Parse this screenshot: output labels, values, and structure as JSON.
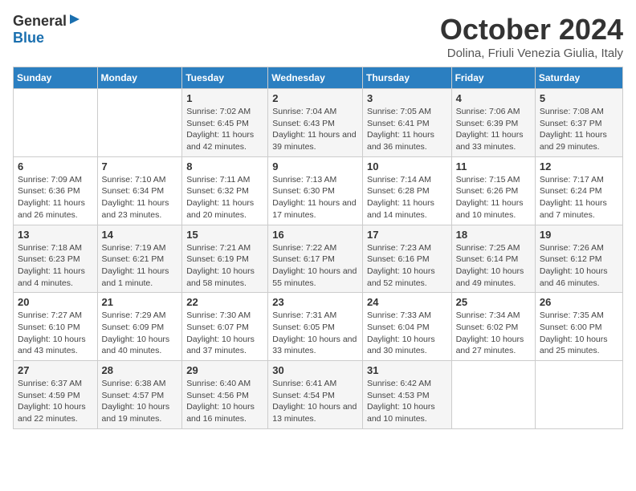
{
  "logo": {
    "line1": "General",
    "arrow": "►",
    "line2": "Blue"
  },
  "title": "October 2024",
  "location": "Dolina, Friuli Venezia Giulia, Italy",
  "days_of_week": [
    "Sunday",
    "Monday",
    "Tuesday",
    "Wednesday",
    "Thursday",
    "Friday",
    "Saturday"
  ],
  "weeks": [
    [
      {
        "day": "",
        "sunrise": "",
        "sunset": "",
        "daylight": ""
      },
      {
        "day": "",
        "sunrise": "",
        "sunset": "",
        "daylight": ""
      },
      {
        "day": "1",
        "sunrise": "Sunrise: 7:02 AM",
        "sunset": "Sunset: 6:45 PM",
        "daylight": "Daylight: 11 hours and 42 minutes."
      },
      {
        "day": "2",
        "sunrise": "Sunrise: 7:04 AM",
        "sunset": "Sunset: 6:43 PM",
        "daylight": "Daylight: 11 hours and 39 minutes."
      },
      {
        "day": "3",
        "sunrise": "Sunrise: 7:05 AM",
        "sunset": "Sunset: 6:41 PM",
        "daylight": "Daylight: 11 hours and 36 minutes."
      },
      {
        "day": "4",
        "sunrise": "Sunrise: 7:06 AM",
        "sunset": "Sunset: 6:39 PM",
        "daylight": "Daylight: 11 hours and 33 minutes."
      },
      {
        "day": "5",
        "sunrise": "Sunrise: 7:08 AM",
        "sunset": "Sunset: 6:37 PM",
        "daylight": "Daylight: 11 hours and 29 minutes."
      }
    ],
    [
      {
        "day": "6",
        "sunrise": "Sunrise: 7:09 AM",
        "sunset": "Sunset: 6:36 PM",
        "daylight": "Daylight: 11 hours and 26 minutes."
      },
      {
        "day": "7",
        "sunrise": "Sunrise: 7:10 AM",
        "sunset": "Sunset: 6:34 PM",
        "daylight": "Daylight: 11 hours and 23 minutes."
      },
      {
        "day": "8",
        "sunrise": "Sunrise: 7:11 AM",
        "sunset": "Sunset: 6:32 PM",
        "daylight": "Daylight: 11 hours and 20 minutes."
      },
      {
        "day": "9",
        "sunrise": "Sunrise: 7:13 AM",
        "sunset": "Sunset: 6:30 PM",
        "daylight": "Daylight: 11 hours and 17 minutes."
      },
      {
        "day": "10",
        "sunrise": "Sunrise: 7:14 AM",
        "sunset": "Sunset: 6:28 PM",
        "daylight": "Daylight: 11 hours and 14 minutes."
      },
      {
        "day": "11",
        "sunrise": "Sunrise: 7:15 AM",
        "sunset": "Sunset: 6:26 PM",
        "daylight": "Daylight: 11 hours and 10 minutes."
      },
      {
        "day": "12",
        "sunrise": "Sunrise: 7:17 AM",
        "sunset": "Sunset: 6:24 PM",
        "daylight": "Daylight: 11 hours and 7 minutes."
      }
    ],
    [
      {
        "day": "13",
        "sunrise": "Sunrise: 7:18 AM",
        "sunset": "Sunset: 6:23 PM",
        "daylight": "Daylight: 11 hours and 4 minutes."
      },
      {
        "day": "14",
        "sunrise": "Sunrise: 7:19 AM",
        "sunset": "Sunset: 6:21 PM",
        "daylight": "Daylight: 11 hours and 1 minute."
      },
      {
        "day": "15",
        "sunrise": "Sunrise: 7:21 AM",
        "sunset": "Sunset: 6:19 PM",
        "daylight": "Daylight: 10 hours and 58 minutes."
      },
      {
        "day": "16",
        "sunrise": "Sunrise: 7:22 AM",
        "sunset": "Sunset: 6:17 PM",
        "daylight": "Daylight: 10 hours and 55 minutes."
      },
      {
        "day": "17",
        "sunrise": "Sunrise: 7:23 AM",
        "sunset": "Sunset: 6:16 PM",
        "daylight": "Daylight: 10 hours and 52 minutes."
      },
      {
        "day": "18",
        "sunrise": "Sunrise: 7:25 AM",
        "sunset": "Sunset: 6:14 PM",
        "daylight": "Daylight: 10 hours and 49 minutes."
      },
      {
        "day": "19",
        "sunrise": "Sunrise: 7:26 AM",
        "sunset": "Sunset: 6:12 PM",
        "daylight": "Daylight: 10 hours and 46 minutes."
      }
    ],
    [
      {
        "day": "20",
        "sunrise": "Sunrise: 7:27 AM",
        "sunset": "Sunset: 6:10 PM",
        "daylight": "Daylight: 10 hours and 43 minutes."
      },
      {
        "day": "21",
        "sunrise": "Sunrise: 7:29 AM",
        "sunset": "Sunset: 6:09 PM",
        "daylight": "Daylight: 10 hours and 40 minutes."
      },
      {
        "day": "22",
        "sunrise": "Sunrise: 7:30 AM",
        "sunset": "Sunset: 6:07 PM",
        "daylight": "Daylight: 10 hours and 37 minutes."
      },
      {
        "day": "23",
        "sunrise": "Sunrise: 7:31 AM",
        "sunset": "Sunset: 6:05 PM",
        "daylight": "Daylight: 10 hours and 33 minutes."
      },
      {
        "day": "24",
        "sunrise": "Sunrise: 7:33 AM",
        "sunset": "Sunset: 6:04 PM",
        "daylight": "Daylight: 10 hours and 30 minutes."
      },
      {
        "day": "25",
        "sunrise": "Sunrise: 7:34 AM",
        "sunset": "Sunset: 6:02 PM",
        "daylight": "Daylight: 10 hours and 27 minutes."
      },
      {
        "day": "26",
        "sunrise": "Sunrise: 7:35 AM",
        "sunset": "Sunset: 6:00 PM",
        "daylight": "Daylight: 10 hours and 25 minutes."
      }
    ],
    [
      {
        "day": "27",
        "sunrise": "Sunrise: 6:37 AM",
        "sunset": "Sunset: 4:59 PM",
        "daylight": "Daylight: 10 hours and 22 minutes."
      },
      {
        "day": "28",
        "sunrise": "Sunrise: 6:38 AM",
        "sunset": "Sunset: 4:57 PM",
        "daylight": "Daylight: 10 hours and 19 minutes."
      },
      {
        "day": "29",
        "sunrise": "Sunrise: 6:40 AM",
        "sunset": "Sunset: 4:56 PM",
        "daylight": "Daylight: 10 hours and 16 minutes."
      },
      {
        "day": "30",
        "sunrise": "Sunrise: 6:41 AM",
        "sunset": "Sunset: 4:54 PM",
        "daylight": "Daylight: 10 hours and 13 minutes."
      },
      {
        "day": "31",
        "sunrise": "Sunrise: 6:42 AM",
        "sunset": "Sunset: 4:53 PM",
        "daylight": "Daylight: 10 hours and 10 minutes."
      },
      {
        "day": "",
        "sunrise": "",
        "sunset": "",
        "daylight": ""
      },
      {
        "day": "",
        "sunrise": "",
        "sunset": "",
        "daylight": ""
      }
    ]
  ]
}
